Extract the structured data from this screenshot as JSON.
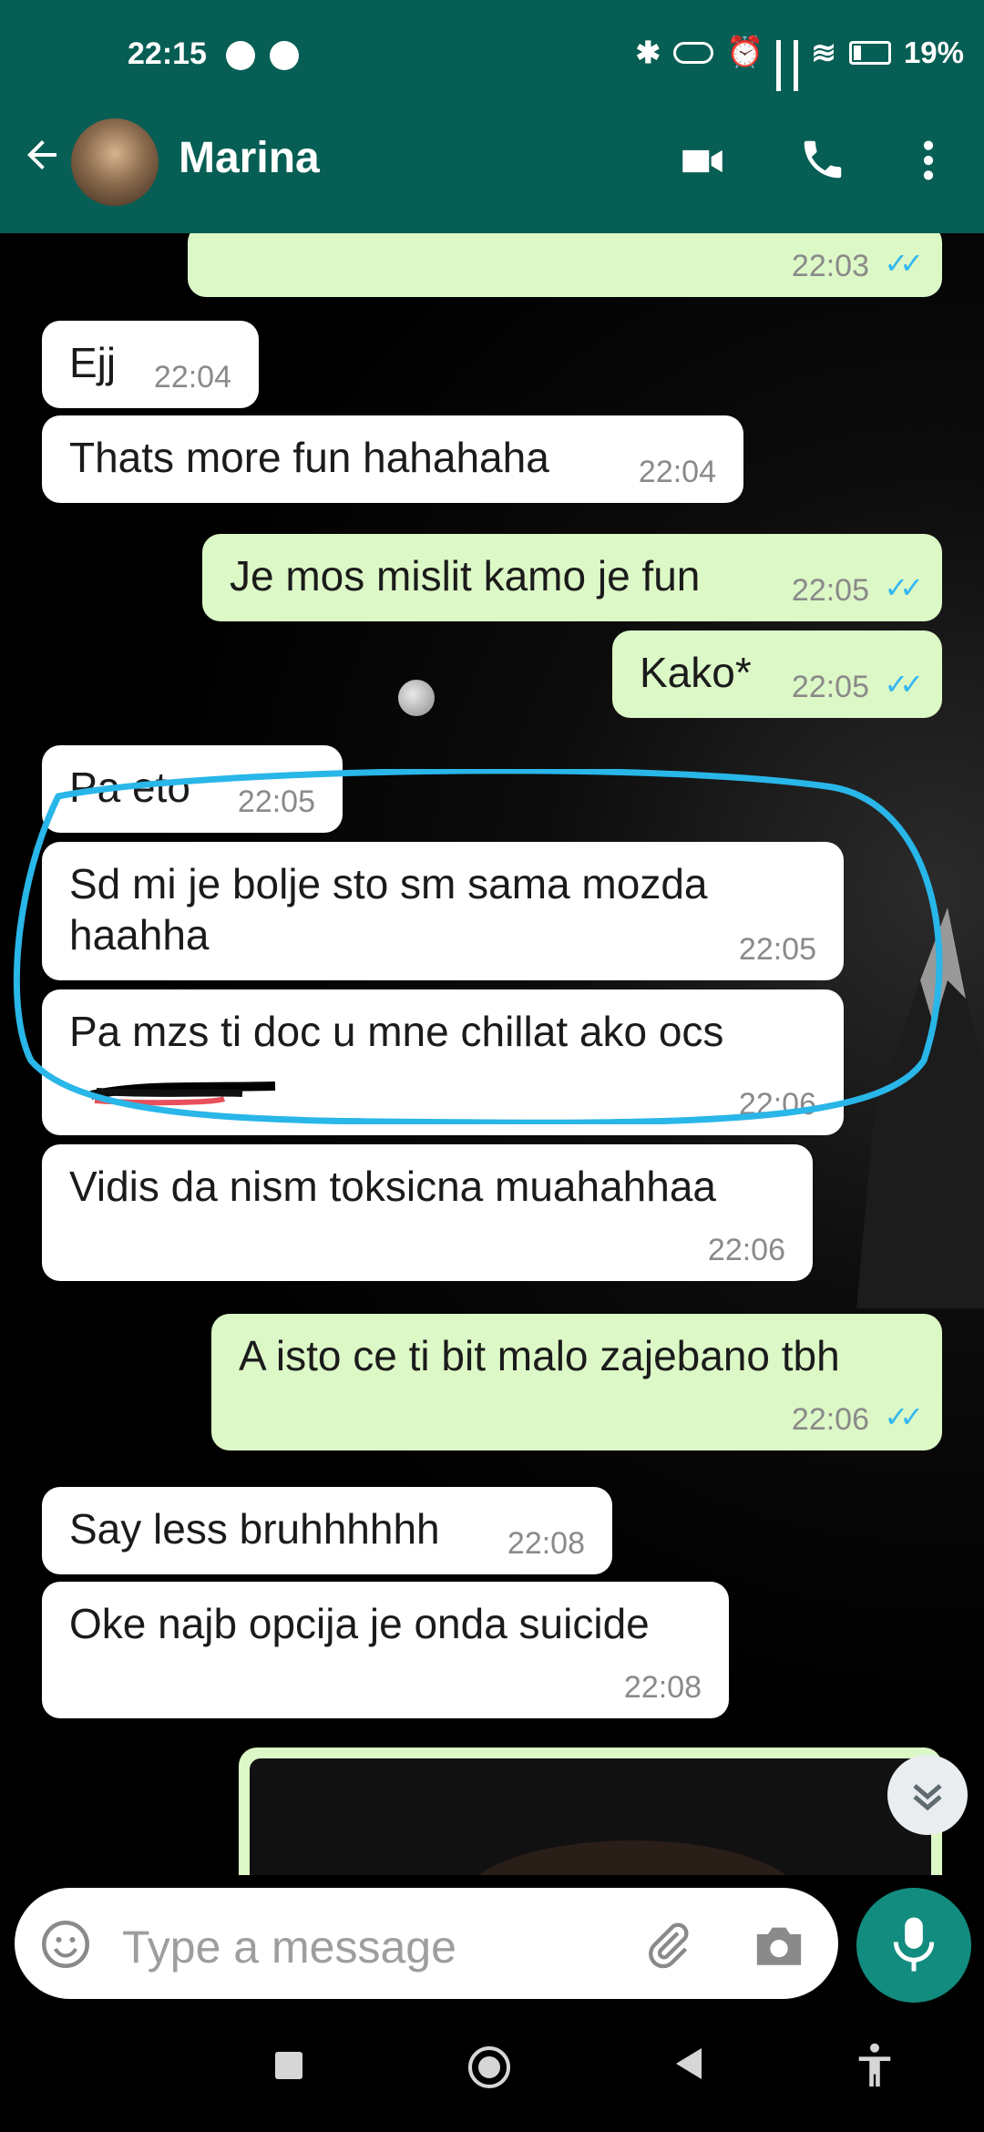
{
  "status_bar": {
    "time": "22:15",
    "battery": "19%"
  },
  "header": {
    "contact_name": "Marina"
  },
  "messages": [
    {
      "dir": "out",
      "text": "",
      "time": "22:03",
      "read": true
    },
    {
      "dir": "in",
      "text": "Ejj",
      "time": "22:04"
    },
    {
      "dir": "in",
      "text": "Thats more fun hahahaha",
      "time": "22:04"
    },
    {
      "dir": "out",
      "text": "Je mos mislit kamo je fun",
      "time": "22:05",
      "read": true
    },
    {
      "dir": "out",
      "text": "Kako*",
      "time": "22:05",
      "read": true
    },
    {
      "dir": "in",
      "text": "Pa eto",
      "time": "22:05"
    },
    {
      "dir": "in",
      "text": "Sd mi je bolje sto sm sama mozda haahha",
      "time": "22:05"
    },
    {
      "dir": "in",
      "text": "Pa mzs ti doc u mne chillat ako ocs",
      "time": "22:06"
    },
    {
      "dir": "in",
      "text": "Vidis da nism toksicna muahahhaa",
      "time": "22:06"
    },
    {
      "dir": "out",
      "text": "A isto ce ti bit malo zajebano tbh",
      "time": "22:06",
      "read": true
    },
    {
      "dir": "in",
      "text": "Say less bruhhhhhh",
      "time": "22:08"
    },
    {
      "dir": "in",
      "text": "Oke najb opcija je onda suicide",
      "time": "22:08"
    }
  ],
  "composer": {
    "placeholder": "Type a message"
  },
  "icons": {
    "read_receipt": "double-check-icon",
    "colors": {
      "header": "#075e54",
      "outgoing": "#dcf8c6",
      "incoming": "#ffffff",
      "mic": "#128c7e",
      "highlight": "#29b6e8"
    }
  }
}
